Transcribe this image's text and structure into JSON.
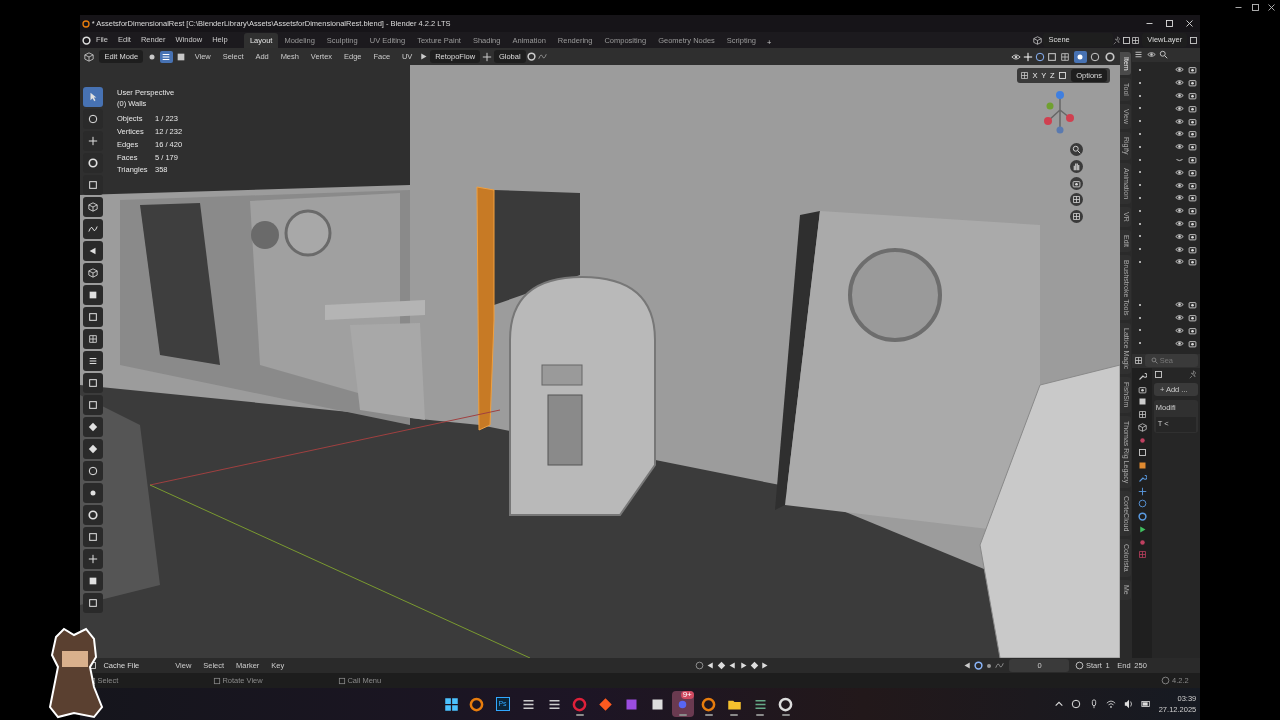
{
  "title_bar": {
    "title": "* AssetsforDimensionalRest [C:\\BlenderLibrary\\Assets\\AssetsforDimensionalRest.blend] - Blender 4.2.2 LTS"
  },
  "menu_bar": {
    "menus": [
      "File",
      "Edit",
      "Render",
      "Window",
      "Help"
    ]
  },
  "workspaces": [
    {
      "label": "Layout",
      "selected": true
    },
    {
      "label": "Modeling",
      "selected": false
    },
    {
      "label": "Sculpting",
      "selected": false
    },
    {
      "label": "UV Editing",
      "selected": false
    },
    {
      "label": "Texture Paint",
      "selected": false
    },
    {
      "label": "Shading",
      "selected": false
    },
    {
      "label": "Animation",
      "selected": false
    },
    {
      "label": "Rendering",
      "selected": false
    },
    {
      "label": "Compositing",
      "selected": false
    },
    {
      "label": "Geometry Nodes",
      "selected": false
    },
    {
      "label": "Scripting",
      "selected": false
    }
  ],
  "add_workspace": "+",
  "scene": {
    "name": "Scene"
  },
  "view_layer": {
    "name": "ViewLayer"
  },
  "viewport_header": {
    "mode": "Edit Mode",
    "select_modes": [
      {
        "selected": false
      },
      {
        "selected": true
      },
      {
        "selected": false
      }
    ],
    "menus": [
      "View",
      "Select",
      "Add",
      "Mesh",
      "Vertex",
      "Edge",
      "Face",
      "UV"
    ],
    "addon": "RetopoFlow",
    "orientation": "Global",
    "shading": [
      {
        "selected": false
      },
      {
        "selected": true
      },
      {
        "selected": false
      },
      {
        "selected": false
      }
    ]
  },
  "viewport_options": {
    "axes": [
      "X",
      "Y",
      "Z"
    ],
    "options": "Options"
  },
  "overlay": {
    "view_name": "User Perspective",
    "object_name": "(0) Walls",
    "stats": [
      {
        "label": "Objects",
        "value": "1 / 223"
      },
      {
        "label": "Vertices",
        "value": "12 / 232"
      },
      {
        "label": "Edges",
        "value": "16 / 420"
      },
      {
        "label": "Faces",
        "value": "5 / 179"
      },
      {
        "label": "Triangles",
        "value": "358"
      }
    ]
  },
  "toolbar": {
    "tools": [
      {
        "selected": true
      },
      {
        "selected": false
      },
      {
        "selected": false
      },
      {
        "selected": false
      },
      {
        "selected": false
      },
      {
        "selected": false
      },
      {
        "selected": false
      },
      {
        "selected": false
      },
      {
        "selected": false
      },
      {
        "selected": false
      },
      {
        "selected": false
      },
      {
        "selected": false
      },
      {
        "selected": false
      },
      {
        "selected": false
      },
      {
        "selected": false
      },
      {
        "selected": false
      },
      {
        "selected": false
      },
      {
        "selected": false
      },
      {
        "selected": false
      },
      {
        "selected": false
      },
      {
        "selected": false
      },
      {
        "selected": false
      },
      {
        "selected": false
      },
      {
        "selected": false
      }
    ]
  },
  "sidebar_tabs": [
    {
      "label": "Item",
      "selected": true
    },
    {
      "label": "Tool",
      "selected": false
    },
    {
      "label": "View",
      "selected": false
    },
    {
      "label": "Rigify",
      "selected": false
    },
    {
      "label": "Animation",
      "selected": false
    },
    {
      "label": "VR",
      "selected": false
    },
    {
      "label": "Edit",
      "selected": false
    },
    {
      "label": "Brushstroke Tools",
      "selected": false
    },
    {
      "label": "Lattice Magic",
      "selected": false
    },
    {
      "label": "FishSim",
      "selected": false
    },
    {
      "label": "Thomas Rig Legacy",
      "selected": false
    },
    {
      "label": "CorteCloud",
      "selected": false
    },
    {
      "label": "Colorista",
      "selected": false
    },
    {
      "label": "Me",
      "selected": false
    }
  ],
  "outliner": {
    "rows": [
      {
        "visible": true
      },
      {
        "visible": true
      },
      {
        "visible": true
      },
      {
        "visible": true
      },
      {
        "visible": true
      },
      {
        "visible": true
      },
      {
        "visible": true
      },
      {
        "visible": false
      },
      {
        "visible": true
      },
      {
        "visible": true
      },
      {
        "visible": true
      },
      {
        "visible": true
      },
      {
        "visible": true
      },
      {
        "visible": true
      },
      {
        "visible": true
      },
      {
        "visible": true
      }
    ],
    "rows_lower": [
      {
        "visible": true
      },
      {
        "visible": true
      },
      {
        "visible": true
      },
      {
        "visible": true
      }
    ]
  },
  "properties": {
    "search_placeholder": "Sea",
    "add_button": "+ Add ...",
    "panel_title": "Modifi",
    "panel_text": "T  <"
  },
  "timeline": {
    "cache": "Cache File",
    "menus": [
      "View",
      "Select",
      "Marker",
      "Key"
    ],
    "current_frame": "0",
    "start_label": "Start",
    "start": "1",
    "end_label": "End",
    "end": "250"
  },
  "status_bar": {
    "hints": [
      "Select",
      "Rotate View",
      "Call Menu"
    ],
    "version": "4.2.2"
  },
  "taskbar": {
    "apps": [
      {
        "running": false
      },
      {
        "running": false
      },
      {
        "running": false,
        "label": "Ps"
      },
      {
        "running": false
      },
      {
        "running": false
      },
      {
        "running": true
      },
      {
        "running": false
      },
      {
        "running": false
      },
      {
        "running": false
      },
      {
        "running": true,
        "badge": "9+"
      },
      {
        "running": true
      },
      {
        "running": true
      },
      {
        "running": true
      },
      {
        "running": true
      }
    ],
    "time": "03:39",
    "date": "27.12.2025"
  }
}
